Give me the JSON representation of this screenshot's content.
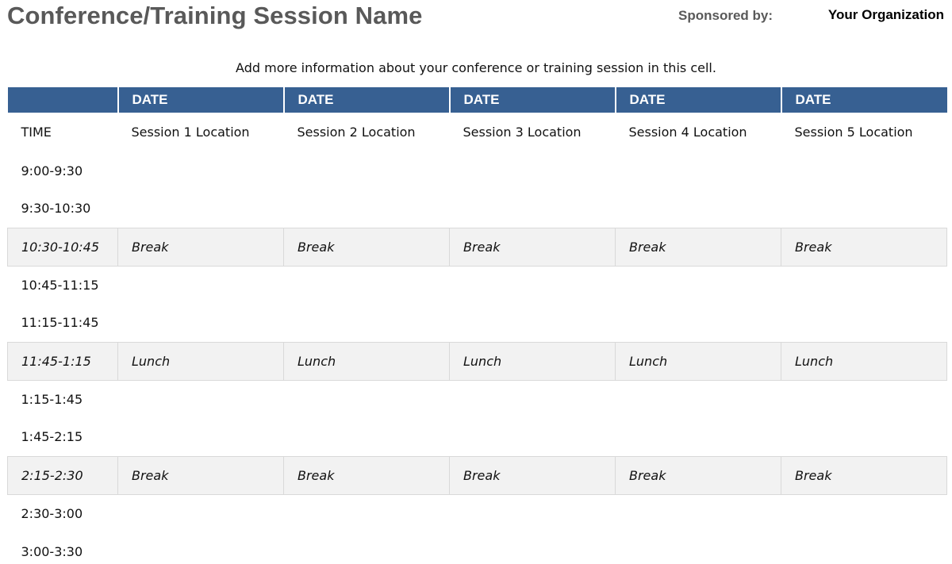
{
  "header": {
    "title": "Conference/Training Session Name",
    "sponsor_label": "Sponsored by:",
    "sponsor_name": "Your Organization"
  },
  "info": "Add more information about your conference or training session in this cell.",
  "colors": {
    "header_fill": "#376092",
    "title_text": "#595959",
    "break_fill": "#f2f2f2"
  },
  "schedule": {
    "date_headers": [
      "DATE",
      "DATE",
      "DATE",
      "DATE",
      "DATE"
    ],
    "time_label": "TIME",
    "locations": [
      "Session 1 Location",
      "Session 2 Location",
      "Session 3 Location",
      "Session 4 Location",
      "Session 5 Location"
    ],
    "rows": [
      {
        "time": "9:00-9:30",
        "type": "session",
        "cells": [
          "",
          "",
          "",
          "",
          ""
        ]
      },
      {
        "time": "9:30-10:30",
        "type": "session",
        "cells": [
          "",
          "",
          "",
          "",
          ""
        ]
      },
      {
        "time": "10:30-10:45",
        "type": "break",
        "cells": [
          "Break",
          "Break",
          "Break",
          "Break",
          "Break"
        ]
      },
      {
        "time": "10:45-11:15",
        "type": "session",
        "cells": [
          "",
          "",
          "",
          "",
          ""
        ]
      },
      {
        "time": "11:15-11:45",
        "type": "session",
        "cells": [
          "",
          "",
          "",
          "",
          ""
        ]
      },
      {
        "time": "11:45-1:15",
        "type": "break",
        "cells": [
          "Lunch",
          "Lunch",
          "Lunch",
          "Lunch",
          "Lunch"
        ]
      },
      {
        "time": "1:15-1:45",
        "type": "session",
        "cells": [
          "",
          "",
          "",
          "",
          ""
        ]
      },
      {
        "time": "1:45-2:15",
        "type": "session",
        "cells": [
          "",
          "",
          "",
          "",
          ""
        ]
      },
      {
        "time": "2:15-2:30",
        "type": "break",
        "cells": [
          "Break",
          "Break",
          "Break",
          "Break",
          "Break"
        ]
      },
      {
        "time": "2:30-3:00",
        "type": "session",
        "cells": [
          "",
          "",
          "",
          "",
          ""
        ]
      },
      {
        "time": "3:00-3:30",
        "type": "session",
        "cells": [
          "",
          "",
          "",
          "",
          ""
        ]
      }
    ]
  }
}
